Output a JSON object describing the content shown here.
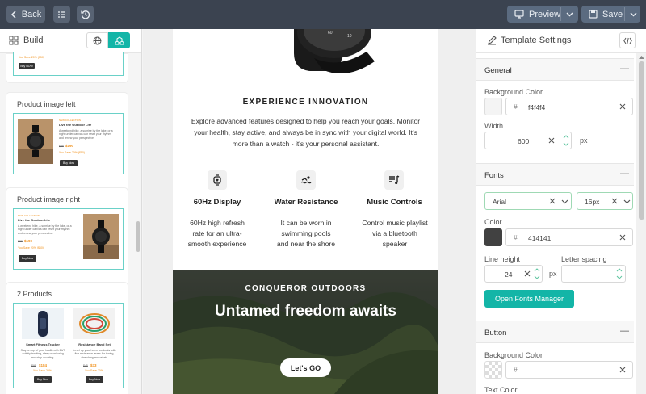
{
  "toolbar": {
    "back_label": "Back",
    "preview_label": "Preview",
    "save_label": "Save"
  },
  "sidebar": {
    "title": "Build",
    "cards": [
      {
        "title": "Product image left"
      },
      {
        "title": "Product image right"
      },
      {
        "title": "2 Products"
      }
    ],
    "partial_card": {
      "save_text": "You Save 20% ($50)",
      "buy": "Buy NOW"
    },
    "left_thumb": {
      "tag": "NEW COLLECTION",
      "heading": "Live the Outdoor Life",
      "body": "A weekend hike, a sunrise by the lake, or a night under canvas can reset your rhythm and renew your perspective.",
      "old_price": "$38",
      "price": "$190",
      "save": "You Save 20% ($50)",
      "buy": "Buy Now"
    },
    "right_thumb": {
      "tag": "NEW COLLECTION",
      "heading": "Live the Outdoor Life",
      "body": "A weekend hike, a sunrise by the lake, or a night under canvas can reset your rhythm and renew your perspective.",
      "old_price": "$38",
      "price": "$190",
      "save": "You Save 20% ($50)",
      "buy": "Buy Now"
    },
    "two_products": [
      {
        "name": "Smart Fitness Tracker",
        "body": "Stay on top of your health with 24/7 activity tracking, sleep monitoring and step counting.",
        "old_price": "$98",
        "price": "$184",
        "save": "You Save 20%",
        "buy": "Buy Now"
      },
      {
        "name": "Resistance Band Set",
        "body": "Level up your home workouts with five resistance levels for toning, stretching and rehab.",
        "old_price": "$45",
        "price": "$33",
        "save": "You Save 20%",
        "buy": "Buy Now"
      }
    ]
  },
  "email": {
    "heading": "EXPERIENCE INNOVATION",
    "intro": "Explore advanced features designed to help you reach your goals. Monitor your health, stay active, and always be in sync with your digital world. It's more than a watch - it's your personal assistant.",
    "features": [
      {
        "icon": "watch-heart-icon",
        "title": "60Hz Display",
        "text": "60Hz high refresh rate for an ultra-smooth experience"
      },
      {
        "icon": "swimming-icon",
        "title": "Water Resistance",
        "text": "It can be worn in swimming pools and near the shore"
      },
      {
        "icon": "music-list-icon",
        "title": "Music Controls",
        "text": "Control music playlist via a bluetooth speaker"
      }
    ],
    "hero": {
      "eyebrow": "CONQUEROR OUTDOORS",
      "headline": "Untamed freedom awaits",
      "cta": "Let's GO"
    }
  },
  "settings": {
    "title": "Template Settings",
    "general": {
      "label": "General",
      "bg_color_label": "Background Color",
      "bg_color_value": "f4f4f4",
      "width_label": "Width",
      "width_value": "600",
      "width_unit": "px"
    },
    "fonts": {
      "label": "Fonts",
      "family": "Arial",
      "size": "16px",
      "color_label": "Color",
      "color_value": "414141",
      "line_height_label": "Line height",
      "line_height_value": "24",
      "line_height_unit": "px",
      "letter_spacing_label": "Letter spacing",
      "letter_spacing_value": "",
      "manager_button": "Open Fonts Manager"
    },
    "button": {
      "label": "Button",
      "bg_color_label": "Background Color",
      "bg_color_value": "",
      "text_color_label": "Text Color"
    },
    "hash": "#",
    "collapse": "—"
  },
  "colors": {
    "accent": "#13b5a7",
    "topbar": "#3b4350",
    "font_color": "#414141",
    "bg_color": "#f4f4f4"
  }
}
